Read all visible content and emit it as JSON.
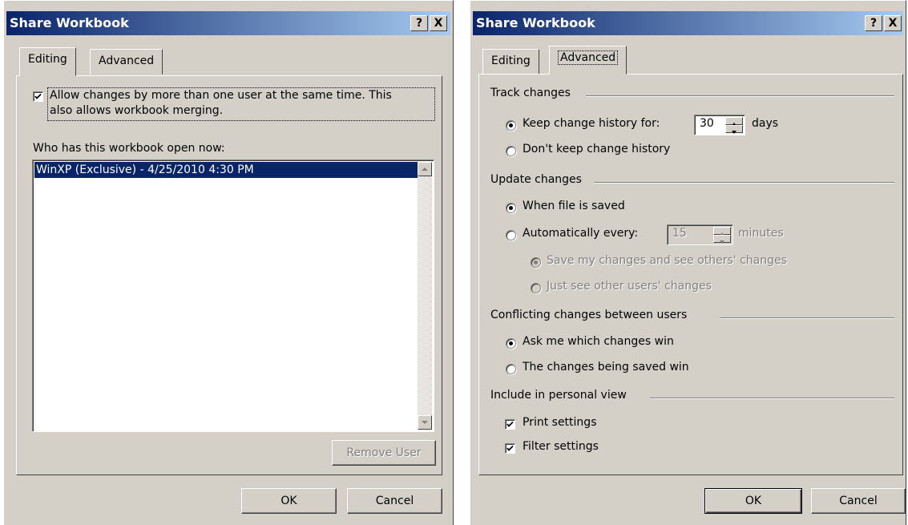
{
  "window1": {
    "title": "Share Workbook",
    "help_glyph": "?",
    "close_glyph": "X",
    "tabs": [
      {
        "label": "Editing",
        "active": true
      },
      {
        "label": "Advanced",
        "active": false
      }
    ],
    "allow_checkbox": {
      "checked": true,
      "line1": "Allow changes by more than one user at the same time.  This",
      "line2": "also allows workbook merging."
    },
    "who_label": "Who has this workbook open now:",
    "users": [
      "WinXP (Exclusive) - 4/25/2010 4:30 PM"
    ],
    "remove_user": "Remove User",
    "ok": "OK",
    "cancel": "Cancel"
  },
  "window2": {
    "title": "Share Workbook",
    "help_glyph": "?",
    "close_glyph": "X",
    "tabs": [
      {
        "label": "Editing",
        "active": false
      },
      {
        "label": "Advanced",
        "active": true
      }
    ],
    "track_changes": {
      "header": "Track changes",
      "keep_history_label": "Keep change history for:",
      "days_value": "30",
      "days_label": "days",
      "dont_keep_label": "Don't keep change history"
    },
    "update_changes": {
      "header": "Update changes",
      "when_saved_label": "When file is saved",
      "auto_label": "Automatically every:",
      "minutes_value": "15",
      "minutes_label": "minutes",
      "save_mine_label": "Save my changes and see others' changes",
      "just_see_label": "Just see other users' changes"
    },
    "conflicting": {
      "header": "Conflicting changes between users",
      "ask_label": "Ask me which changes win",
      "saved_win_label": "The changes being saved win"
    },
    "personal_view": {
      "header": "Include in personal view",
      "print_label": "Print settings",
      "filter_label": "Filter settings"
    },
    "ok": "OK",
    "cancel": "Cancel"
  },
  "colors": {
    "title_start": "#0a246a",
    "title_end": "#a6caf0",
    "face": "#d4d0c8",
    "selection": "#0a246a"
  }
}
